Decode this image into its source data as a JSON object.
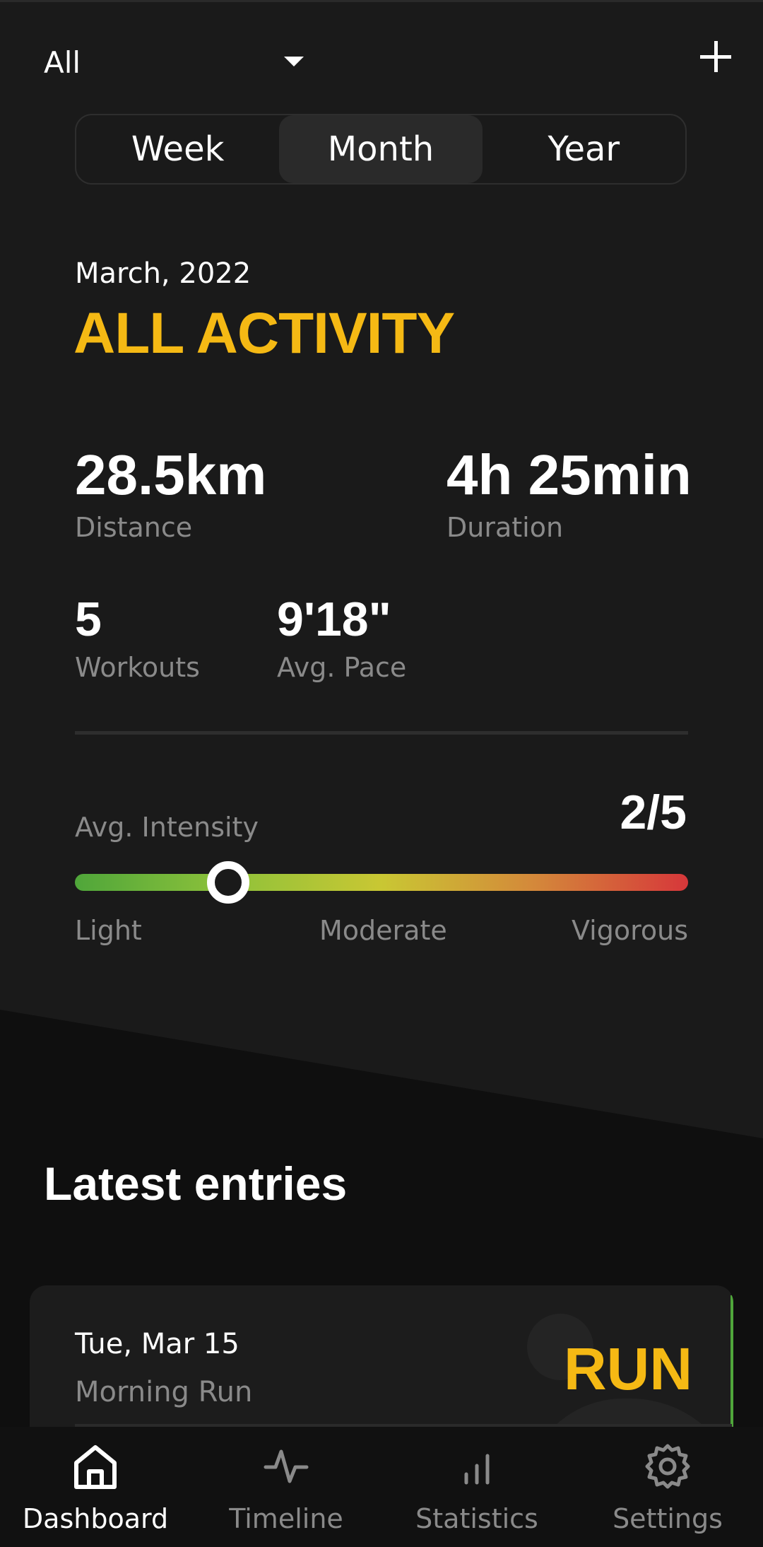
{
  "header": {
    "filter_value": "All",
    "add_icon": "plus-icon"
  },
  "period_tabs": [
    {
      "label": "Week",
      "active": false
    },
    {
      "label": "Month",
      "active": true
    },
    {
      "label": "Year",
      "active": false
    }
  ],
  "summary": {
    "period": "March, 2022",
    "title": "ALL ACTIVITY",
    "stats": {
      "distance": {
        "value": "28.5km",
        "label": "Distance"
      },
      "duration": {
        "value": "4h 25min",
        "label": "Duration"
      },
      "workouts": {
        "value": "5",
        "label": "Workouts"
      },
      "pace": {
        "value": "9'18\"",
        "label": "Avg. Pace"
      }
    },
    "intensity": {
      "label": "Avg. Intensity",
      "value": "2/5",
      "level": 2,
      "max": 5,
      "scale_labels": [
        "Light",
        "Moderate",
        "Vigorous"
      ]
    }
  },
  "latest": {
    "title": "Latest entries",
    "entries": [
      {
        "date": "Tue, Mar 15",
        "name": "Morning Run",
        "type": "RUN",
        "accent_color": "#4fa63a"
      }
    ]
  },
  "bottom_nav": [
    {
      "label": "Dashboard",
      "icon": "home-icon",
      "active": true
    },
    {
      "label": "Timeline",
      "icon": "activity-icon",
      "active": false
    },
    {
      "label": "Statistics",
      "icon": "bar-chart-icon",
      "active": false
    },
    {
      "label": "Settings",
      "icon": "gear-icon",
      "active": false
    }
  ],
  "colors": {
    "accent": "#f5b914",
    "background": "#0f0f0f",
    "surface": "#1a1a1a",
    "muted_text": "#8a8a8a"
  }
}
